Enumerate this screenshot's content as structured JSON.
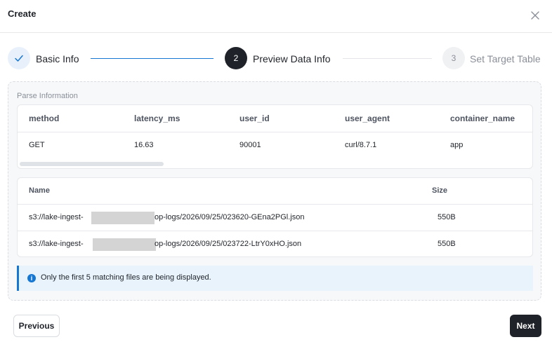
{
  "dialog": {
    "title": "Create"
  },
  "stepper": {
    "steps": [
      {
        "number": "1",
        "label": "Basic Info",
        "status": "done"
      },
      {
        "number": "2",
        "label": "Preview Data Info",
        "status": "active"
      },
      {
        "number": "3",
        "label": "Set Target Table",
        "status": "pending"
      }
    ]
  },
  "parse": {
    "section_label": "Parse Information",
    "columns": [
      "method",
      "latency_ms",
      "user_id",
      "user_agent",
      "container_name"
    ],
    "rows": [
      [
        "GET",
        "16.63",
        "90001",
        "curl/8.7.1",
        "app"
      ]
    ]
  },
  "files": {
    "columns": [
      "Name",
      "Size"
    ],
    "rows": [
      {
        "name_prefix": "s3://lake-ingest-",
        "name_suffix": "op-logs/2026/09/25/023620-GEna2PGl.json",
        "size": "550B"
      },
      {
        "name_prefix": "s3://lake-ingest- ",
        "name_suffix": "op-logs/2026/09/25/023722-LtrY0xHO.json",
        "size": "550B"
      }
    ]
  },
  "notice": {
    "icon": "info-icon",
    "text": "Only the first 5 matching files are being displayed."
  },
  "footer": {
    "previous_label": "Previous",
    "next_label": "Next"
  },
  "colors": {
    "accent": "#1677d2",
    "dark": "#1f2329",
    "notice_bg": "#e8f3fc"
  }
}
